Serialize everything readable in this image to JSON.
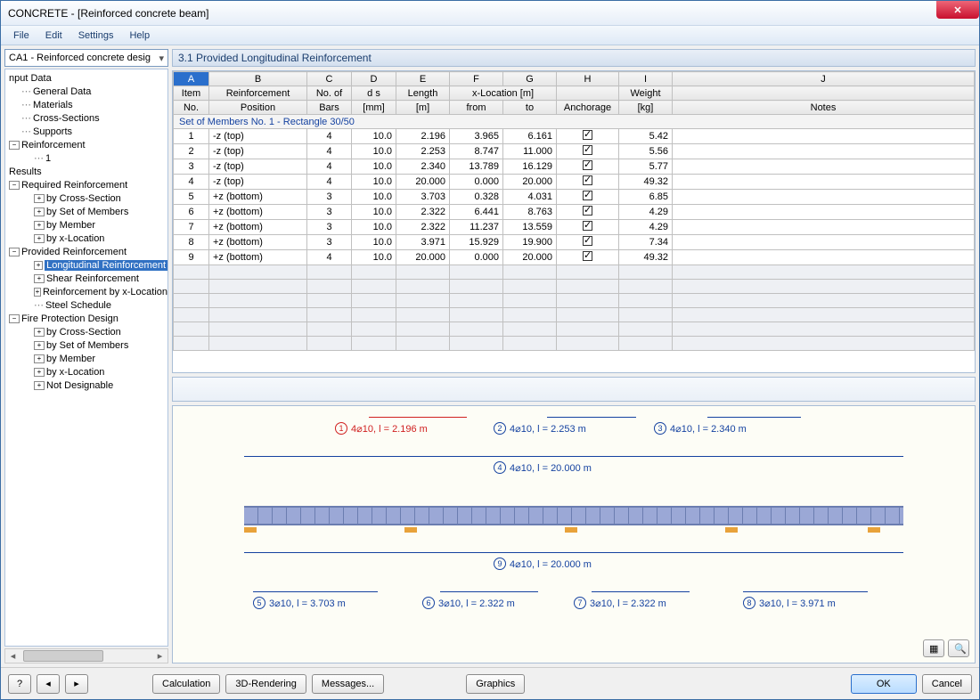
{
  "window_title": "CONCRETE - [Reinforced concrete beam]",
  "menu": {
    "file": "File",
    "edit": "Edit",
    "settings": "Settings",
    "help": "Help"
  },
  "combo_value": "CA1 - Reinforced concrete desig",
  "tree": {
    "input_data": "nput Data",
    "general_data": "General Data",
    "materials": "Materials",
    "cross_sections": "Cross-Sections",
    "supports": "Supports",
    "reinforcement": "Reinforcement",
    "reinforcement_1": "1",
    "results": "Results",
    "required": "Required Reinforcement",
    "req_by_cs": "by Cross-Section",
    "req_by_som": "by Set of Members",
    "req_by_member": "by Member",
    "req_by_xloc": "by x-Location",
    "provided": "Provided Reinforcement",
    "prov_long": "Longitudinal Reinforcement",
    "prov_shear": "Shear Reinforcement",
    "prov_by_xloc": "Reinforcement by x-Location",
    "prov_steel": "Steel Schedule",
    "fire": "Fire Protection Design",
    "fire_by_cs": "by Cross-Section",
    "fire_by_som": "by Set of Members",
    "fire_by_member": "by Member",
    "fire_by_xloc": "by x-Location",
    "fire_not": "Not Designable"
  },
  "panel_title": "3.1 Provided Longitudinal Reinforcement",
  "col_letters": {
    "A": "A",
    "B": "B",
    "C": "C",
    "D": "D",
    "E": "E",
    "F": "F",
    "G": "G",
    "H": "H",
    "I": "I",
    "J": "J"
  },
  "col_head1": {
    "A": "Item",
    "B": "Reinforcement",
    "C": "No. of",
    "D": "d s",
    "E": "Length",
    "FG": "x-Location [m]",
    "H": "",
    "I": "Weight",
    "J": ""
  },
  "col_head2": {
    "A": "No.",
    "B": "Position",
    "C": "Bars",
    "D": "[mm]",
    "E": "[m]",
    "F": "from",
    "G": "to",
    "H": "Anchorage",
    "I": "[kg]",
    "J": "Notes"
  },
  "section_title": "Set of Members No. 1  -  Rectangle 30/50",
  "rows": [
    {
      "no": "1",
      "pos": "-z (top)",
      "bars": "4",
      "ds": "10.0",
      "len": "2.196",
      "from": "3.965",
      "to": "6.161",
      "anc": true,
      "wt": "5.42",
      "notes": ""
    },
    {
      "no": "2",
      "pos": "-z (top)",
      "bars": "4",
      "ds": "10.0",
      "len": "2.253",
      "from": "8.747",
      "to": "11.000",
      "anc": true,
      "wt": "5.56",
      "notes": ""
    },
    {
      "no": "3",
      "pos": "-z (top)",
      "bars": "4",
      "ds": "10.0",
      "len": "2.340",
      "from": "13.789",
      "to": "16.129",
      "anc": true,
      "wt": "5.77",
      "notes": ""
    },
    {
      "no": "4",
      "pos": "-z (top)",
      "bars": "4",
      "ds": "10.0",
      "len": "20.000",
      "from": "0.000",
      "to": "20.000",
      "anc": true,
      "wt": "49.32",
      "notes": ""
    },
    {
      "no": "5",
      "pos": "+z (bottom)",
      "bars": "3",
      "ds": "10.0",
      "len": "3.703",
      "from": "0.328",
      "to": "4.031",
      "anc": true,
      "wt": "6.85",
      "notes": ""
    },
    {
      "no": "6",
      "pos": "+z (bottom)",
      "bars": "3",
      "ds": "10.0",
      "len": "2.322",
      "from": "6.441",
      "to": "8.763",
      "anc": true,
      "wt": "4.29",
      "notes": ""
    },
    {
      "no": "7",
      "pos": "+z (bottom)",
      "bars": "3",
      "ds": "10.0",
      "len": "2.322",
      "from": "11.237",
      "to": "13.559",
      "anc": true,
      "wt": "4.29",
      "notes": ""
    },
    {
      "no": "8",
      "pos": "+z (bottom)",
      "bars": "3",
      "ds": "10.0",
      "len": "3.971",
      "from": "15.929",
      "to": "19.900",
      "anc": true,
      "wt": "7.34",
      "notes": ""
    },
    {
      "no": "9",
      "pos": "+z (bottom)",
      "bars": "4",
      "ds": "10.0",
      "len": "20.000",
      "from": "0.000",
      "to": "20.000",
      "anc": true,
      "wt": "49.32",
      "notes": ""
    }
  ],
  "gfx_labels": {
    "l1": {
      "num": "1",
      "txt": "4⌀10, l = 2.196 m",
      "color": "#d02020"
    },
    "l2": {
      "num": "2",
      "txt": "4⌀10, l = 2.253 m",
      "color": "#1542a0"
    },
    "l3": {
      "num": "3",
      "txt": "4⌀10, l = 2.340 m",
      "color": "#1542a0"
    },
    "l4": {
      "num": "4",
      "txt": "4⌀10, l = 20.000 m",
      "color": "#1542a0"
    },
    "l5": {
      "num": "5",
      "txt": "3⌀10, l = 3.703 m",
      "color": "#1542a0"
    },
    "l6": {
      "num": "6",
      "txt": "3⌀10, l = 2.322 m",
      "color": "#1542a0"
    },
    "l7": {
      "num": "7",
      "txt": "3⌀10, l = 2.322 m",
      "color": "#1542a0"
    },
    "l8": {
      "num": "8",
      "txt": "3⌀10, l = 3.971 m",
      "color": "#1542a0"
    },
    "l9": {
      "num": "9",
      "txt": "4⌀10, l = 20.000 m",
      "color": "#1542a0"
    }
  },
  "footer": {
    "calculation": "Calculation",
    "rendering": "3D-Rendering",
    "messages": "Messages...",
    "graphics": "Graphics",
    "ok": "OK",
    "cancel": "Cancel"
  }
}
